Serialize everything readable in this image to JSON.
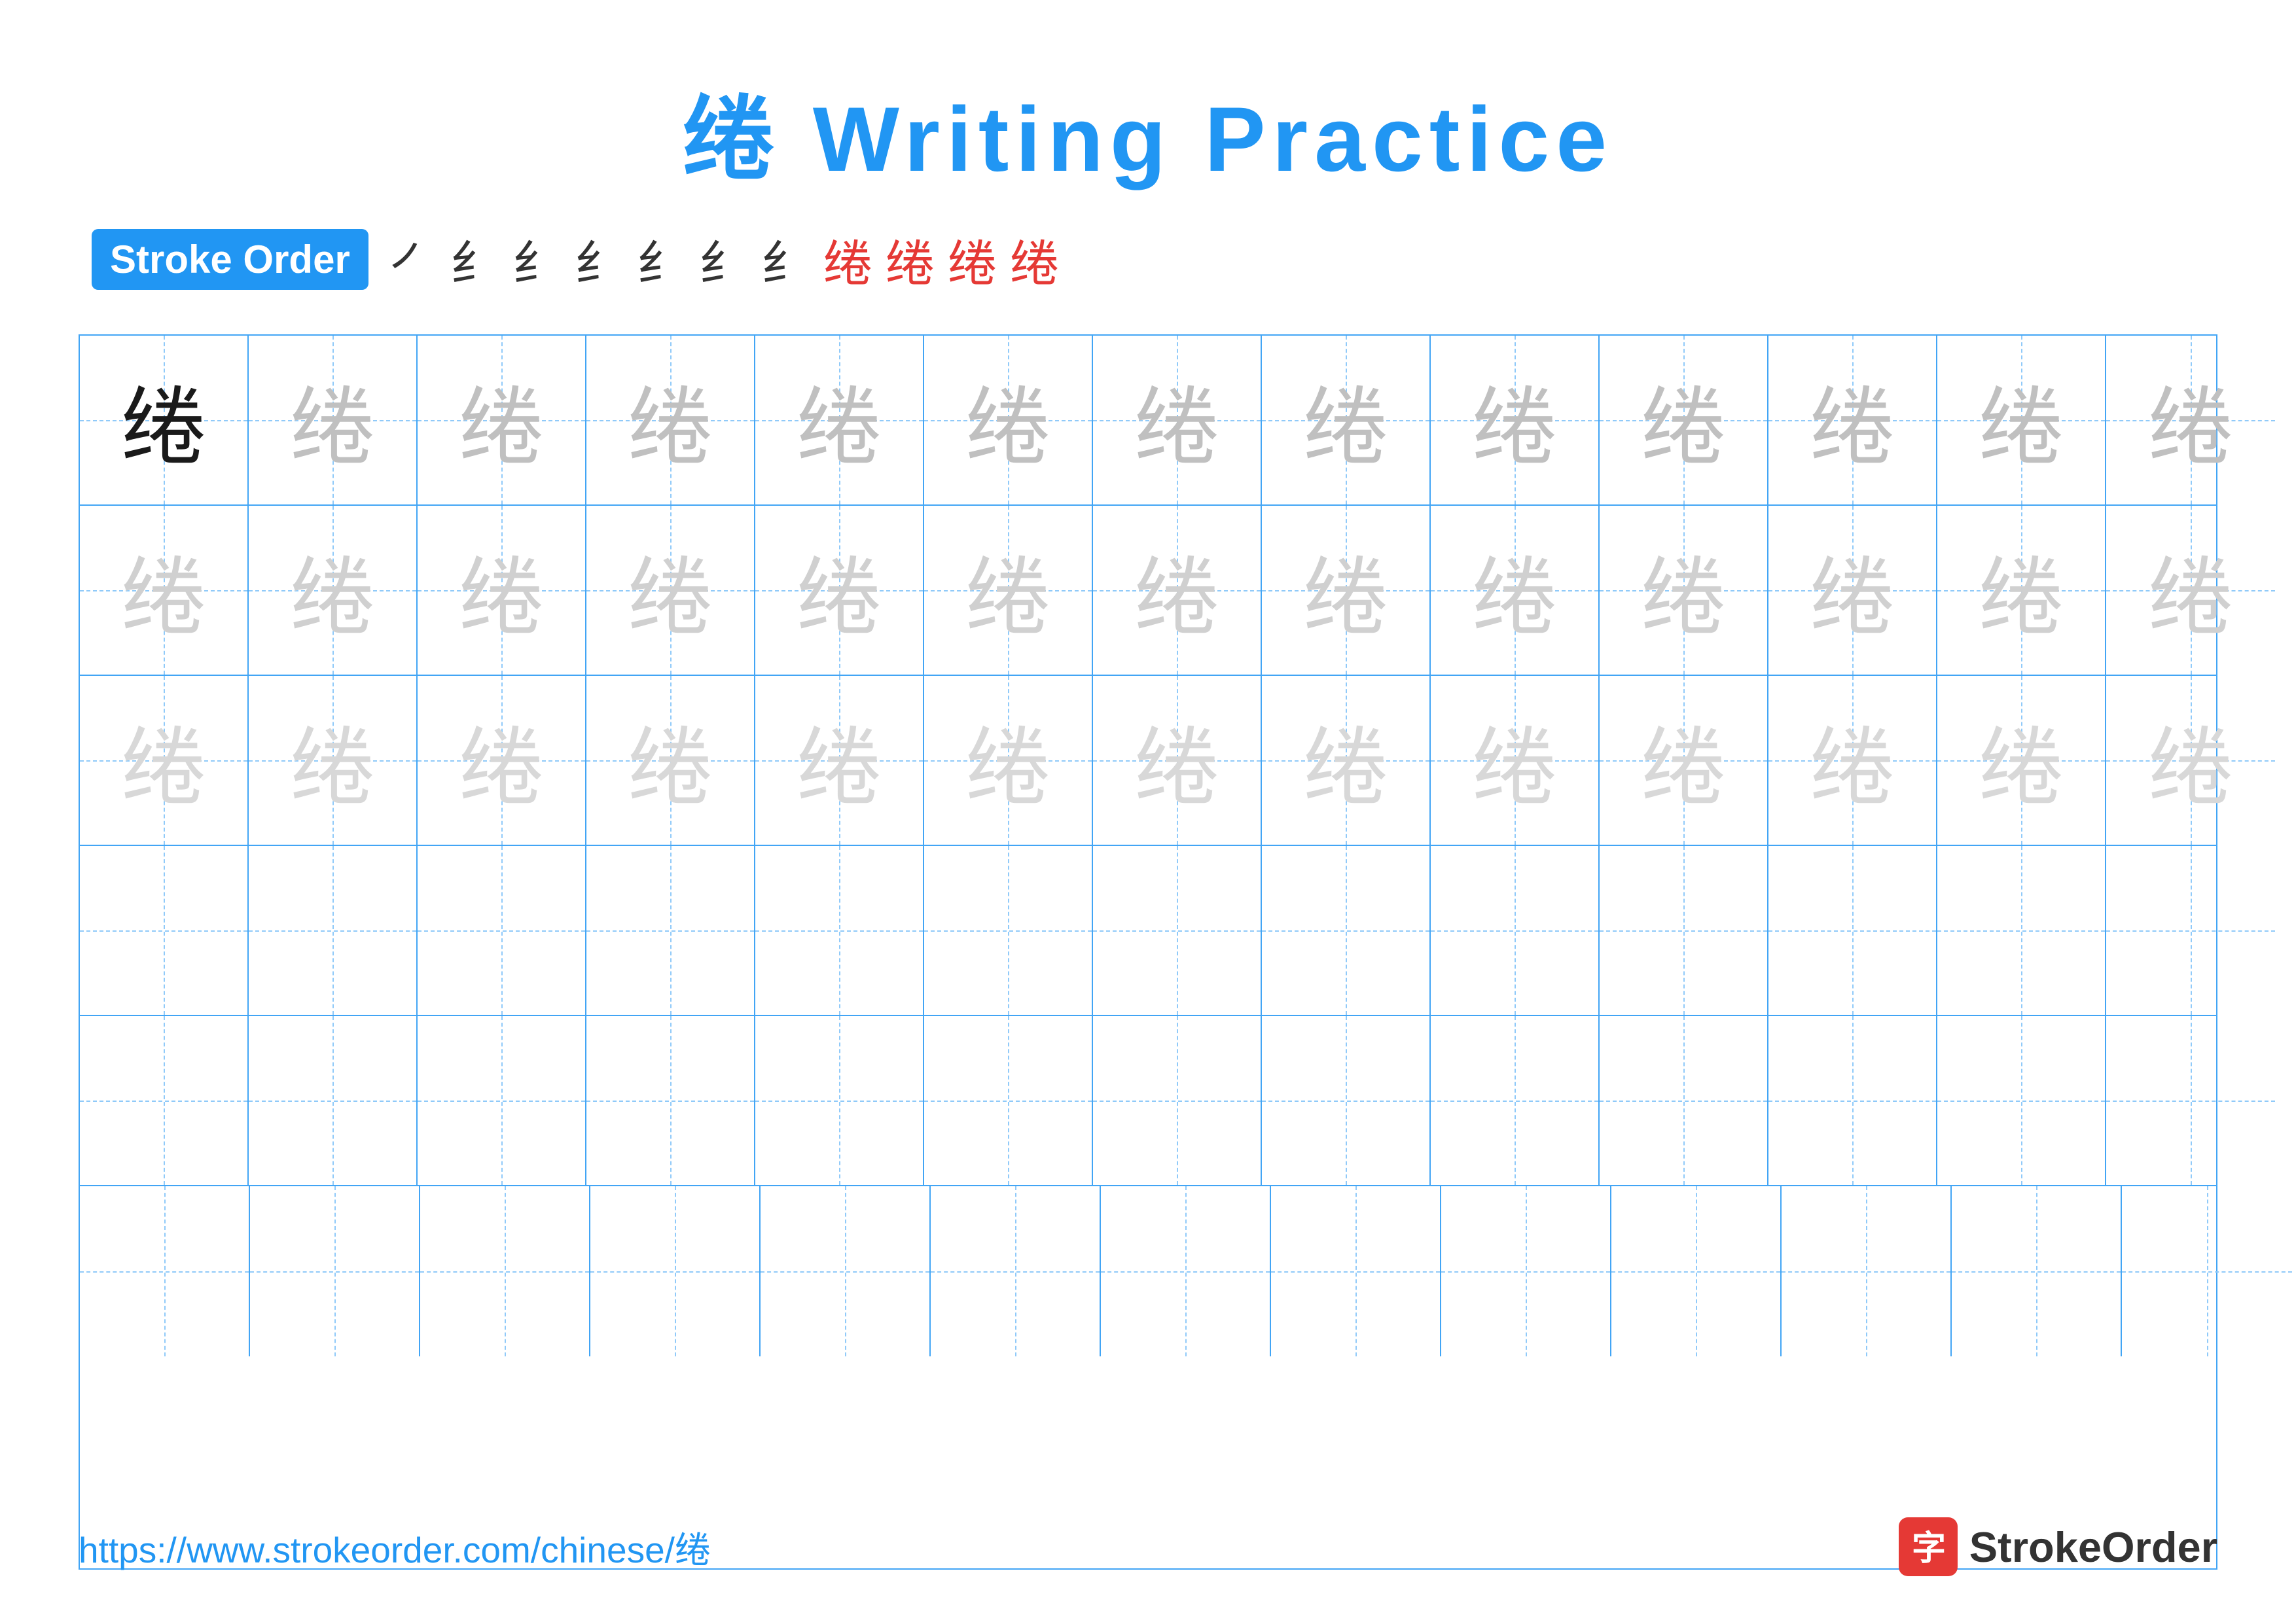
{
  "title": "绻 Writing Practice",
  "strokeOrder": {
    "badge": "Stroke Order",
    "steps": [
      "㇒",
      "纟",
      "纟",
      "纟",
      "纟̈",
      "纟̈",
      "纟̈",
      "纟̈",
      "纟",
      "绻",
      "绻"
    ]
  },
  "character": "绻",
  "grid": {
    "rows": 6,
    "cols": 13
  },
  "footer": {
    "url": "https://www.strokeorder.com/chinese/绻",
    "logoText": "StrokeOrder"
  }
}
